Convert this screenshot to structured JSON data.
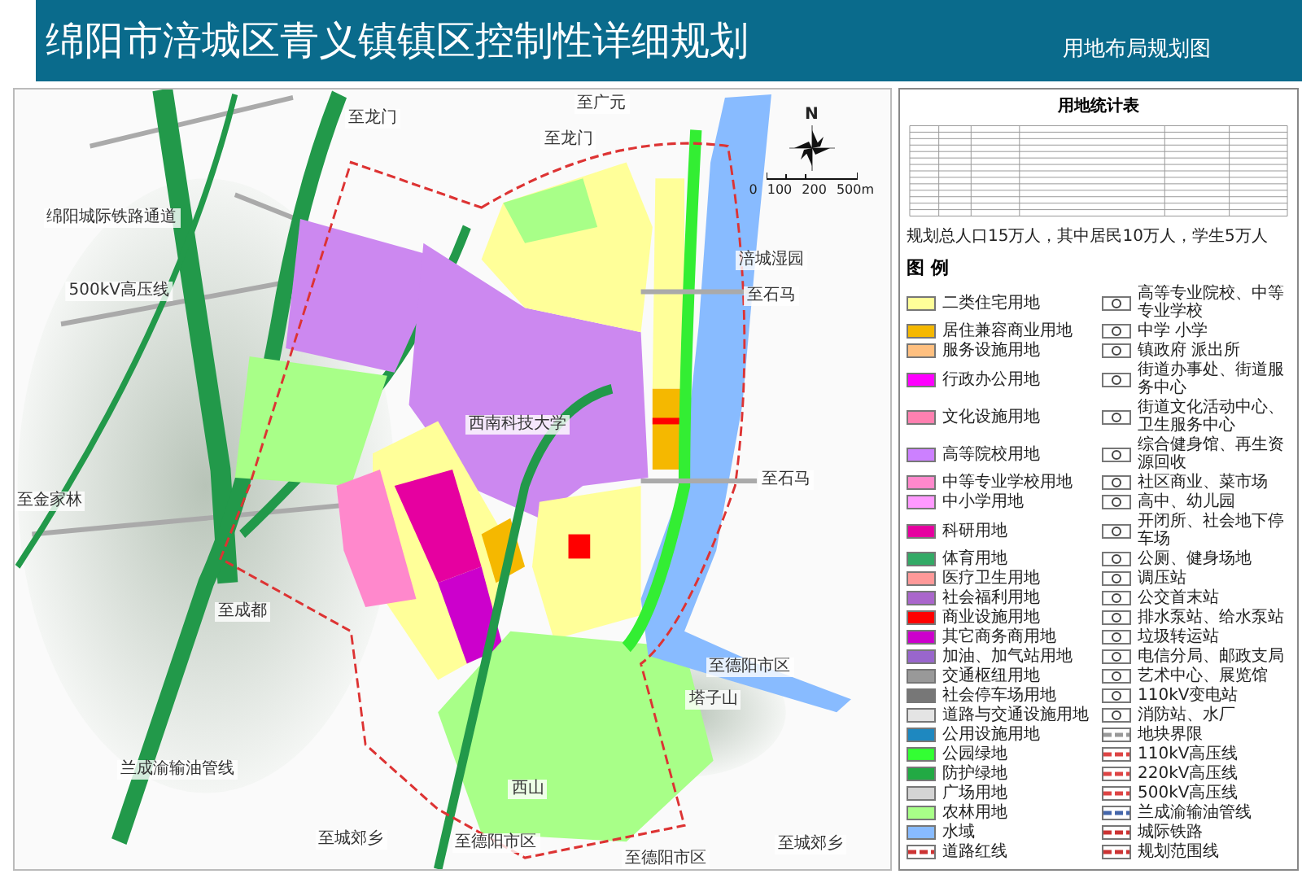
{
  "header": {
    "title": "绵阳市涪城区青义镇镇区控制性详细规划",
    "subtitle": "用地布局规划图"
  },
  "map": {
    "labels": [
      {
        "text": "至龙门"
      },
      {
        "text": "至广元"
      },
      {
        "text": "至龙门"
      },
      {
        "text": "绵阳城际铁路通道"
      },
      {
        "text": "500kV高压线"
      },
      {
        "text": "至金家林"
      },
      {
        "text": "西南科技大学"
      },
      {
        "text": "涪城湿园"
      },
      {
        "text": "至石马"
      },
      {
        "text": "至石马"
      },
      {
        "text": "至成都"
      },
      {
        "text": "兰成渝输油管线"
      },
      {
        "text": "西山"
      },
      {
        "text": "至德阳市区"
      },
      {
        "text": "塔子山"
      },
      {
        "text": "至城郊乡"
      },
      {
        "text": "至德阳市区"
      },
      {
        "text": "至德阳市区"
      },
      {
        "text": "至城郊乡"
      }
    ],
    "compass": {
      "north": "N"
    },
    "scale": [
      "0",
      "100",
      "200",
      "500m"
    ]
  },
  "stats_table": {
    "title": "用地统计表",
    "note": "规划总人口15万人，其中居民10万人，学生5万人"
  },
  "legend": {
    "title": "图 例",
    "left": [
      {
        "label": "二类住宅用地",
        "kind": "fill",
        "color": "#ffff99"
      },
      {
        "label": "居住兼容商业用地",
        "kind": "fill",
        "color": "#f5b800"
      },
      {
        "label": "服务设施用地",
        "kind": "fill",
        "color": "#ffc080"
      },
      {
        "label": "行政办公用地",
        "kind": "fill",
        "color": "#ff00ff"
      },
      {
        "label": "文化设施用地",
        "kind": "fill",
        "color": "#ff80b0"
      },
      {
        "label": "高等院校用地",
        "kind": "fill",
        "color": "#cc80ff"
      },
      {
        "label": "中等专业学校用地",
        "kind": "fill",
        "color": "#ff88cc"
      },
      {
        "label": "中小学用地",
        "kind": "fill",
        "color": "#ff99ff"
      },
      {
        "label": "科研用地",
        "kind": "fill",
        "color": "#e600a0"
      },
      {
        "label": "体育用地",
        "kind": "fill",
        "color": "#33aa66"
      },
      {
        "label": "医疗卫生用地",
        "kind": "fill",
        "color": "#ff9999"
      },
      {
        "label": "社会福利用地",
        "kind": "fill",
        "color": "#aa66cc"
      },
      {
        "label": "商业设施用地",
        "kind": "fill",
        "color": "#ff0000"
      },
      {
        "label": "其它商务商用地",
        "kind": "fill",
        "color": "#cc00cc"
      },
      {
        "label": "加油、加气站用地",
        "kind": "fill",
        "color": "#9966cc"
      },
      {
        "label": "交通枢纽用地",
        "kind": "fill",
        "color": "#999999"
      },
      {
        "label": "社会停车场用地",
        "kind": "fill",
        "color": "#777777"
      },
      {
        "label": "道路与交通设施用地",
        "kind": "fill",
        "color": "#e4e4e4"
      },
      {
        "label": "公用设施用地",
        "kind": "fill",
        "color": "#1e88c0"
      },
      {
        "label": "公园绿地",
        "kind": "fill",
        "color": "#33ff33"
      },
      {
        "label": "防护绿地",
        "kind": "fill",
        "color": "#22aa44"
      },
      {
        "label": "广场用地",
        "kind": "fill",
        "color": "#d4d4d4"
      },
      {
        "label": "农林用地",
        "kind": "fill",
        "color": "#a8ff88"
      },
      {
        "label": "水域",
        "kind": "fill",
        "color": "#88bbff"
      },
      {
        "label": "道路红线",
        "kind": "line",
        "color": "#cc3333"
      }
    ],
    "right": [
      {
        "label": "高等专业院校、中等专业学校",
        "kind": "symbol"
      },
      {
        "label": "中学 小学",
        "kind": "symbol"
      },
      {
        "label": "镇政府 派出所",
        "kind": "symbol"
      },
      {
        "label": "街道办事处、街道服务中心",
        "kind": "symbol"
      },
      {
        "label": "街道文化活动中心、卫生服务中心",
        "kind": "symbol"
      },
      {
        "label": "综合健身馆、再生资源回收",
        "kind": "symbol"
      },
      {
        "label": "社区商业、菜市场",
        "kind": "symbol"
      },
      {
        "label": "高中、幼儿园",
        "kind": "symbol"
      },
      {
        "label": "开闭所、社会地下停车场",
        "kind": "symbol"
      },
      {
        "label": "公厕、健身场地",
        "kind": "symbol"
      },
      {
        "label": "调压站",
        "kind": "symbol"
      },
      {
        "label": "公交首末站",
        "kind": "symbol"
      },
      {
        "label": "排水泵站、给水泵站",
        "kind": "symbol"
      },
      {
        "label": "垃圾转运站",
        "kind": "symbol"
      },
      {
        "label": "电信分局、邮政支局",
        "kind": "symbol"
      },
      {
        "label": "艺术中心、展览馆",
        "kind": "symbol"
      },
      {
        "label": "110kV变电站",
        "kind": "symbol"
      },
      {
        "label": "消防站、水厂",
        "kind": "symbol"
      },
      {
        "label": "地块界限",
        "kind": "line",
        "color": "#999999"
      },
      {
        "label": "110kV高压线",
        "kind": "line",
        "color": "#dd4444"
      },
      {
        "label": "220kV高压线",
        "kind": "line",
        "color": "#dd4444"
      },
      {
        "label": "500kV高压线",
        "kind": "line",
        "color": "#dd4444"
      },
      {
        "label": "兰成渝输油管线",
        "kind": "line",
        "color": "#4466aa"
      },
      {
        "label": "城际铁路",
        "kind": "line",
        "color": "#cc3333"
      },
      {
        "label": "规划范围线",
        "kind": "line",
        "color": "#cc3333"
      }
    ]
  }
}
